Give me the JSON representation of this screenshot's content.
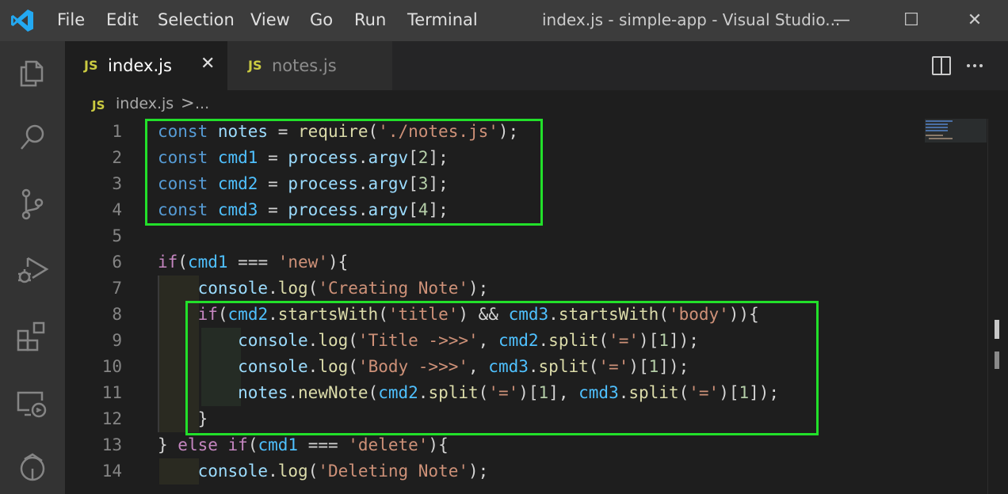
{
  "titlebar": {
    "menu": [
      "File",
      "Edit",
      "Selection",
      "View",
      "Go",
      "Run",
      "Terminal"
    ],
    "window_title": "index.js - simple-app - Visual Studio...",
    "minimize": "—",
    "maximize": "☐",
    "close": "✕"
  },
  "tabs": [
    {
      "icon": "JS",
      "label": "index.js",
      "active": true,
      "close": "✕"
    },
    {
      "icon": "JS",
      "label": "notes.js",
      "active": false
    }
  ],
  "breadcrumb": {
    "icon": "JS",
    "file": "index.js",
    "separator": ">",
    "more": "..."
  },
  "editor": {
    "line_numbers": [
      "1",
      "2",
      "3",
      "4",
      "5",
      "6",
      "7",
      "8",
      "9",
      "10",
      "11",
      "12",
      "13",
      "14"
    ],
    "lines": [
      [
        [
          "kw",
          "const "
        ],
        [
          "var",
          "notes"
        ],
        [
          "pun",
          " = "
        ],
        [
          "fn",
          "require"
        ],
        [
          "pun",
          "("
        ],
        [
          "str",
          "'./notes.js'"
        ],
        [
          "pun",
          ");"
        ]
      ],
      [
        [
          "kw",
          "const "
        ],
        [
          "cst",
          "cmd1"
        ],
        [
          "pun",
          " = "
        ],
        [
          "var",
          "process"
        ],
        [
          "pun",
          "."
        ],
        [
          "var",
          "argv"
        ],
        [
          "pun",
          "["
        ],
        [
          "num",
          "2"
        ],
        [
          "pun",
          "];"
        ]
      ],
      [
        [
          "kw",
          "const "
        ],
        [
          "cst",
          "cmd2"
        ],
        [
          "pun",
          " = "
        ],
        [
          "var",
          "process"
        ],
        [
          "pun",
          "."
        ],
        [
          "var",
          "argv"
        ],
        [
          "pun",
          "["
        ],
        [
          "num",
          "3"
        ],
        [
          "pun",
          "];"
        ]
      ],
      [
        [
          "kw",
          "const "
        ],
        [
          "cst",
          "cmd3"
        ],
        [
          "pun",
          " = "
        ],
        [
          "var",
          "process"
        ],
        [
          "pun",
          "."
        ],
        [
          "var",
          "argv"
        ],
        [
          "pun",
          "["
        ],
        [
          "num",
          "4"
        ],
        [
          "pun",
          "];"
        ]
      ],
      [],
      [
        [
          "kwc",
          "if"
        ],
        [
          "pun",
          "("
        ],
        [
          "cst",
          "cmd1"
        ],
        [
          "pun",
          " === "
        ],
        [
          "str",
          "'new'"
        ],
        [
          "pun",
          "){"
        ]
      ],
      [
        [
          "pun",
          "    "
        ],
        [
          "var",
          "console"
        ],
        [
          "pun",
          "."
        ],
        [
          "fn",
          "log"
        ],
        [
          "pun",
          "("
        ],
        [
          "str",
          "'Creating Note'"
        ],
        [
          "pun",
          ");"
        ]
      ],
      [
        [
          "pun",
          "    "
        ],
        [
          "kwc",
          "if"
        ],
        [
          "pun",
          "("
        ],
        [
          "cst",
          "cmd2"
        ],
        [
          "pun",
          "."
        ],
        [
          "fn",
          "startsWith"
        ],
        [
          "pun",
          "("
        ],
        [
          "str",
          "'title'"
        ],
        [
          "pun",
          ") && "
        ],
        [
          "cst",
          "cmd3"
        ],
        [
          "pun",
          "."
        ],
        [
          "fn",
          "startsWith"
        ],
        [
          "pun",
          "("
        ],
        [
          "str",
          "'body'"
        ],
        [
          "pun",
          "))"
        ],
        [
          "pun",
          "{"
        ]
      ],
      [
        [
          "pun",
          "        "
        ],
        [
          "var",
          "console"
        ],
        [
          "pun",
          "."
        ],
        [
          "fn",
          "log"
        ],
        [
          "pun",
          "("
        ],
        [
          "str",
          "'Title ->>>'"
        ],
        [
          "pun",
          ", "
        ],
        [
          "cst",
          "cmd2"
        ],
        [
          "pun",
          "."
        ],
        [
          "fn",
          "split"
        ],
        [
          "pun",
          "("
        ],
        [
          "str",
          "'='"
        ],
        [
          "pun",
          ")["
        ],
        [
          "num",
          "1"
        ],
        [
          "pun",
          "]);"
        ]
      ],
      [
        [
          "pun",
          "        "
        ],
        [
          "var",
          "console"
        ],
        [
          "pun",
          "."
        ],
        [
          "fn",
          "log"
        ],
        [
          "pun",
          "("
        ],
        [
          "str",
          "'Body ->>>'"
        ],
        [
          "pun",
          ", "
        ],
        [
          "cst",
          "cmd3"
        ],
        [
          "pun",
          "."
        ],
        [
          "fn",
          "split"
        ],
        [
          "pun",
          "("
        ],
        [
          "str",
          "'='"
        ],
        [
          "pun",
          ")["
        ],
        [
          "num",
          "1"
        ],
        [
          "pun",
          "]);"
        ]
      ],
      [
        [
          "pun",
          "        "
        ],
        [
          "var",
          "notes"
        ],
        [
          "pun",
          "."
        ],
        [
          "fn",
          "newNote"
        ],
        [
          "pun",
          "("
        ],
        [
          "cst",
          "cmd2"
        ],
        [
          "pun",
          "."
        ],
        [
          "fn",
          "split"
        ],
        [
          "pun",
          "("
        ],
        [
          "str",
          "'='"
        ],
        [
          "pun",
          ")["
        ],
        [
          "num",
          "1"
        ],
        [
          "pun",
          "], "
        ],
        [
          "cst",
          "cmd3"
        ],
        [
          "pun",
          "."
        ],
        [
          "fn",
          "split"
        ],
        [
          "pun",
          "("
        ],
        [
          "str",
          "'='"
        ],
        [
          "pun",
          ")["
        ],
        [
          "num",
          "1"
        ],
        [
          "pun",
          "]);"
        ]
      ],
      [
        [
          "pun",
          "    }"
        ]
      ],
      [
        [
          "pun",
          "} "
        ],
        [
          "kwc",
          "else if"
        ],
        [
          "pun",
          "("
        ],
        [
          "cst",
          "cmd1"
        ],
        [
          "pun",
          " === "
        ],
        [
          "str",
          "'delete'"
        ],
        [
          "pun",
          "){"
        ]
      ],
      [
        [
          "pun",
          "    "
        ],
        [
          "var",
          "console"
        ],
        [
          "pun",
          "."
        ],
        [
          "fn",
          "log"
        ],
        [
          "pun",
          "("
        ],
        [
          "str",
          "'Deleting Note'"
        ],
        [
          "pun",
          ");"
        ]
      ]
    ]
  },
  "colors": {
    "highlight_box": "#22e02a",
    "accent": "#007acc",
    "js_icon": "#cbcb41"
  },
  "activity_icons": [
    "explorer-icon",
    "search-icon",
    "source-control-icon",
    "run-debug-icon",
    "extensions-icon",
    "remote-explorer-icon",
    "accounts-icon"
  ]
}
